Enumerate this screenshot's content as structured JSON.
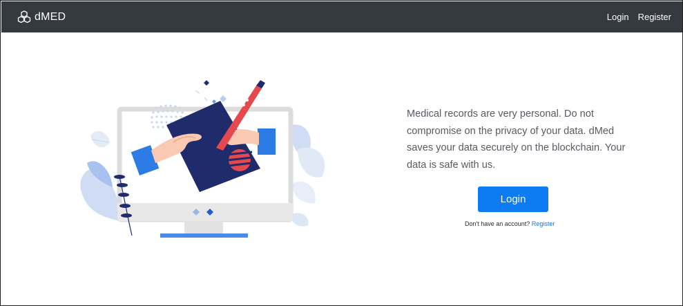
{
  "navbar": {
    "brand": "dMED",
    "brand_icon": "cubes-icon",
    "links": [
      {
        "label": "Login"
      },
      {
        "label": "Register"
      }
    ],
    "background": "#343a40"
  },
  "main": {
    "tagline": "Medical records are very personal. Do not compromise on the privacy of your data. dMed saves your data securely on the blockchain. Your data is safe with us.",
    "login_button": "Login",
    "no_account_text": "Don't have an account?",
    "register_link": "Register"
  },
  "colors": {
    "accent": "#0d7bf2",
    "navy": "#1f2b6b",
    "coral": "#e5484d"
  }
}
